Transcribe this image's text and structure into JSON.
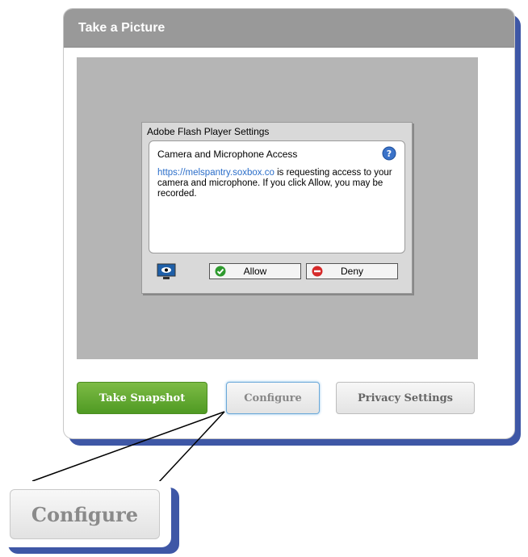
{
  "panel": {
    "title": "Take a Picture"
  },
  "flash_dialog": {
    "title": "Adobe Flash Player Settings",
    "heading": "Camera and Microphone Access",
    "link": "https://melspantry.soxbox.co",
    "message": " is requesting access to your camera and microphone. If you click Allow, you may be recorded.",
    "allow_label": "Allow",
    "deny_label": "Deny"
  },
  "buttons": {
    "snapshot_label": "Take Snapshot",
    "configure_label": "Configure",
    "privacy_label": "Privacy Settings"
  },
  "zoom_callout": {
    "configure_label": "Configure"
  },
  "colors": {
    "accent_blue": "#3e57a6",
    "header_gray": "#999999",
    "snapshot_green": "#5aa52d"
  }
}
